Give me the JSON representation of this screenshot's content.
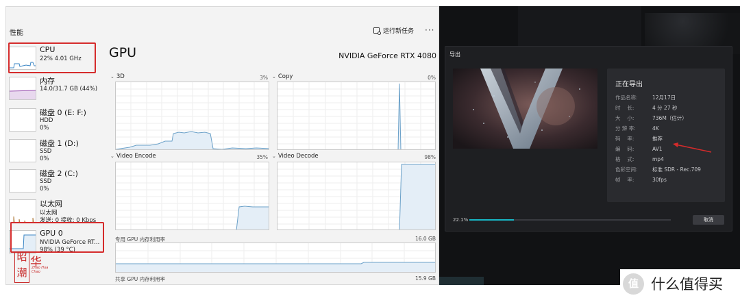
{
  "task_manager": {
    "title": "性能",
    "run_task_label": "运行新任务",
    "more_label": "···",
    "sidebar": {
      "items": [
        {
          "name": "CPU",
          "line1": "22% 4.01 GHz",
          "line2": ""
        },
        {
          "name": "内存",
          "line1": "14.0/31.7 GB (44%)",
          "line2": ""
        },
        {
          "name": "磁盘 0 (E: F:)",
          "line1": "HDD",
          "line2": "0%"
        },
        {
          "name": "磁盘 1 (D:)",
          "line1": "SSD",
          "line2": "0%"
        },
        {
          "name": "磁盘 2 (C:)",
          "line1": "SSD",
          "line2": "0%"
        },
        {
          "name": "以太网",
          "line1": "以太网",
          "line2": "发送: 0 接收: 0 Kbps"
        },
        {
          "name": "GPU 0",
          "line1": "NVIDIA GeForce RT...",
          "line2": "98% (39 °C)"
        }
      ]
    },
    "main": {
      "title": "GPU",
      "model": "NVIDIA GeForce RTX 4080",
      "engines": [
        {
          "label": "3D",
          "percent": "3%"
        },
        {
          "label": "Copy",
          "percent": "0%"
        },
        {
          "label": "Video Encode",
          "percent": "35%"
        },
        {
          "label": "Video Decode",
          "percent": "98%"
        }
      ],
      "dedicated_memory": {
        "label": "专用 GPU 内存利用率",
        "value": "16.0 GB"
      },
      "shared_memory": {
        "label": "共享 GPU 内存利用率",
        "value": "15.9 GB"
      }
    },
    "watermark": {
      "line1": "昭",
      "line2": "潮",
      "hua": "华",
      "latin": "Zhao Hua Chao"
    }
  },
  "export_dialog": {
    "title": "导出",
    "info_title": "正在导出",
    "rows": [
      {
        "key": "作品名称:",
        "value": "12月17日"
      },
      {
        "key": "时　 长:",
        "value": "4 分 27 秒"
      },
      {
        "key": "大　 小:",
        "value": "736M（估计）"
      },
      {
        "key": "分 辨 率:",
        "value": "4K"
      },
      {
        "key": "码　 率:",
        "value": "推荐"
      },
      {
        "key": "编　 码:",
        "value": "AV1"
      },
      {
        "key": "格　 式:",
        "value": "mp4"
      },
      {
        "key": "色彩空间:",
        "value": "标准 SDR - Rec.709"
      },
      {
        "key": "帧　 率:",
        "value": "30fps"
      }
    ],
    "progress_text": "22.1%",
    "progress_value": 0.221,
    "cancel_label": "取消",
    "accent": "#18b7c6"
  },
  "brand": {
    "circle_text": "值",
    "name": "什么值得买"
  },
  "colors": {
    "highlight_box": "#d52b2b",
    "graph_line": "#6aa0c8",
    "graph_fill": "#e4eef7"
  }
}
